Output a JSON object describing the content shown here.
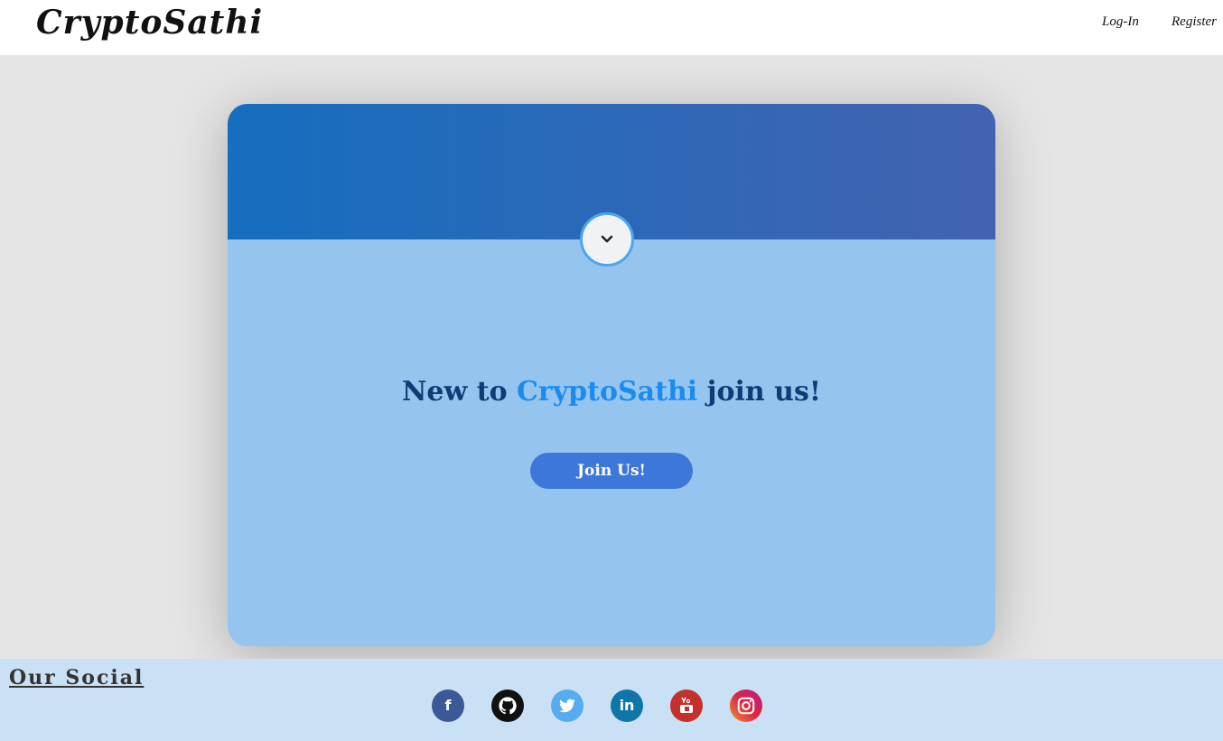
{
  "navbar": {
    "brand": "CryptoSathi",
    "login_label": "Log-In",
    "register_label": "Register"
  },
  "hero": {
    "headline_prefix": "New to ",
    "headline_accent": "CryptoSathi",
    "headline_suffix": " join us!",
    "join_button_label": "Join Us!",
    "toggle_icon": "chevron-down-icon"
  },
  "footer": {
    "title": "Our Social",
    "socials": [
      {
        "name": "facebook",
        "icon": "facebook-icon",
        "glyph": "f"
      },
      {
        "name": "github",
        "icon": "github-icon",
        "glyph": ""
      },
      {
        "name": "twitter",
        "icon": "twitter-icon",
        "glyph": ""
      },
      {
        "name": "linkedin",
        "icon": "linkedin-icon",
        "glyph": "in"
      },
      {
        "name": "youtube",
        "icon": "youtube-icon",
        "glyph": ""
      },
      {
        "name": "instagram",
        "icon": "instagram-icon",
        "glyph": ""
      }
    ]
  },
  "colors": {
    "header_gradient_start": "#166ebf",
    "header_gradient_end": "#4263b1",
    "card_body": "#95c5ee",
    "accent": "#1a8cf0",
    "join_button": "#3d77d9",
    "footer_bg": "#cae0f5"
  }
}
